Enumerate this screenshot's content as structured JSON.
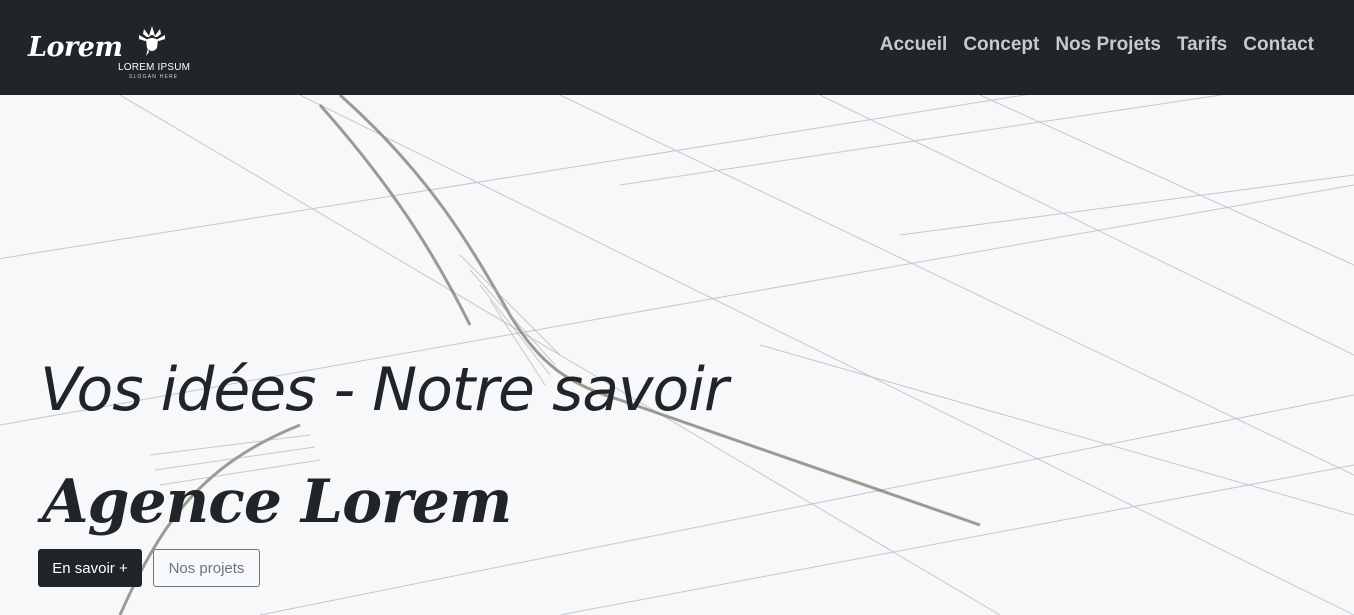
{
  "header": {
    "brand": "Lorem",
    "logo_text": "LOREM IPSUM",
    "logo_subtext": "SLOGAN HERE",
    "logo_icon": "feather-headdress-icon"
  },
  "nav": {
    "items": [
      {
        "label": "Accueil"
      },
      {
        "label": "Concept"
      },
      {
        "label": "Nos Projets"
      },
      {
        "label": "Tarifs"
      },
      {
        "label": "Contact"
      }
    ]
  },
  "hero": {
    "headline": "Vos idées - Notre savoir",
    "agency": "Agence Lorem",
    "primary_button": "En savoir +",
    "secondary_button": "Nos projets"
  },
  "colors": {
    "navbar_bg": "#212529",
    "text_dark": "#212529",
    "nav_link": "#c8c9ca",
    "outline": "#6c757d"
  }
}
